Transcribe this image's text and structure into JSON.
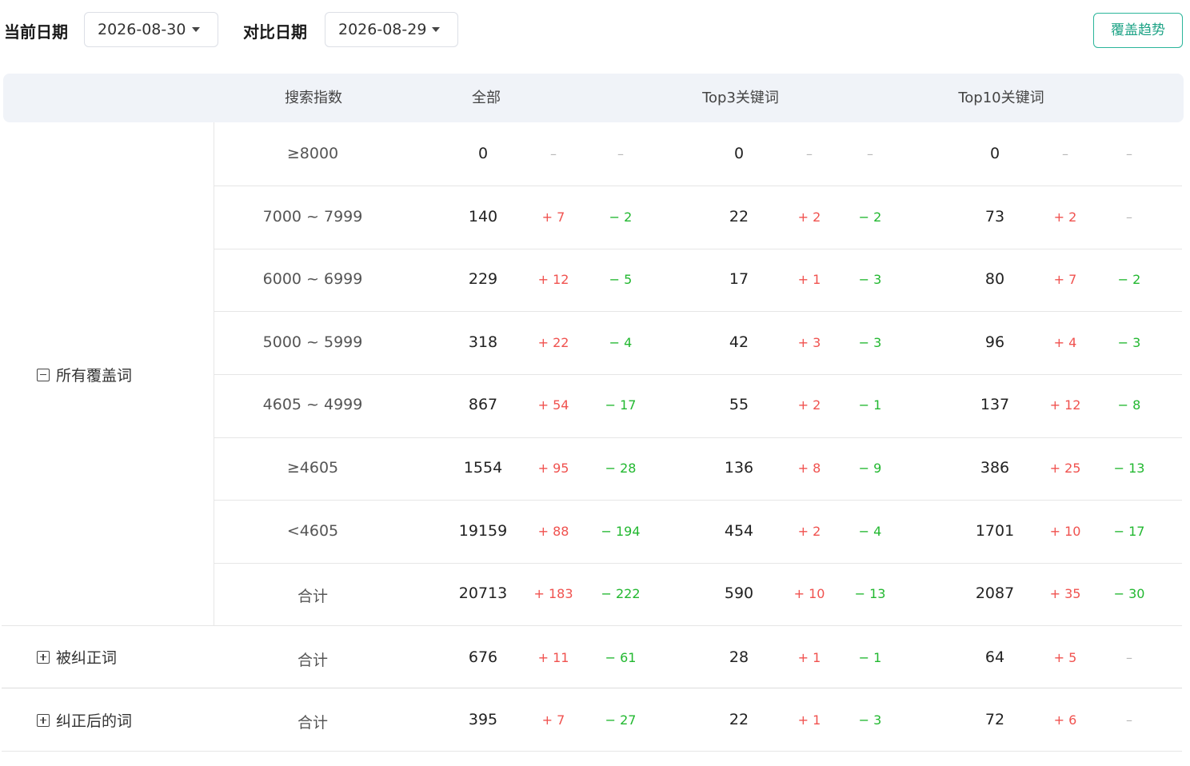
{
  "toolbar": {
    "current_label": "当前日期",
    "current_date": "2026-08-30",
    "compare_label": "对比日期",
    "compare_date": "2026-08-29",
    "trend_button": "覆盖趋势"
  },
  "table": {
    "headers": [
      "搜索指数",
      "全部",
      "Top3关键词",
      "Top10关键词"
    ],
    "groups": {
      "all": "所有覆盖词",
      "corrected": "被纠正词",
      "after": "纠正后的词"
    },
    "rows": [
      {
        "range": "≥8000",
        "all": "0",
        "all_up": "–",
        "all_down": "–",
        "t3": "0",
        "t3_up": "–",
        "t3_down": "–",
        "t10": "0",
        "t10_up": "–",
        "t10_down": "–"
      },
      {
        "range": "7000 ~ 7999",
        "all": "140",
        "all_up": "+ 7",
        "all_down": "− 2",
        "t3": "22",
        "t3_up": "+ 2",
        "t3_down": "− 2",
        "t10": "73",
        "t10_up": "+ 2",
        "t10_down": "–"
      },
      {
        "range": "6000 ~ 6999",
        "all": "229",
        "all_up": "+ 12",
        "all_down": "− 5",
        "t3": "17",
        "t3_up": "+ 1",
        "t3_down": "− 3",
        "t10": "80",
        "t10_up": "+ 7",
        "t10_down": "− 2"
      },
      {
        "range": "5000 ~ 5999",
        "all": "318",
        "all_up": "+ 22",
        "all_down": "− 4",
        "t3": "42",
        "t3_up": "+ 3",
        "t3_down": "− 3",
        "t10": "96",
        "t10_up": "+ 4",
        "t10_down": "− 3"
      },
      {
        "range": "4605 ~ 4999",
        "all": "867",
        "all_up": "+ 54",
        "all_down": "− 17",
        "t3": "55",
        "t3_up": "+ 2",
        "t3_down": "− 1",
        "t10": "137",
        "t10_up": "+ 12",
        "t10_down": "− 8"
      },
      {
        "range": "≥4605",
        "all": "1554",
        "all_up": "+ 95",
        "all_down": "− 28",
        "t3": "136",
        "t3_up": "+ 8",
        "t3_down": "− 9",
        "t10": "386",
        "t10_up": "+ 25",
        "t10_down": "− 13"
      },
      {
        "range": "<4605",
        "all": "19159",
        "all_up": "+ 88",
        "all_down": "− 194",
        "t3": "454",
        "t3_up": "+ 2",
        "t3_down": "− 4",
        "t10": "1701",
        "t10_up": "+ 10",
        "t10_down": "− 17"
      },
      {
        "range": "合计",
        "all": "20713",
        "all_up": "+ 183",
        "all_down": "− 222",
        "t3": "590",
        "t3_up": "+ 10",
        "t3_down": "− 13",
        "t10": "2087",
        "t10_up": "+ 35",
        "t10_down": "− 30"
      },
      {
        "range": "合计",
        "all": "676",
        "all_up": "+ 11",
        "all_down": "− 61",
        "t3": "28",
        "t3_up": "+ 1",
        "t3_down": "− 1",
        "t10": "64",
        "t10_up": "+ 5",
        "t10_down": "–"
      },
      {
        "range": "合计",
        "all": "395",
        "all_up": "+ 7",
        "all_down": "− 27",
        "t3": "22",
        "t3_up": "+ 1",
        "t3_down": "− 3",
        "t10": "72",
        "t10_up": "+ 6",
        "t10_down": "–"
      }
    ]
  }
}
